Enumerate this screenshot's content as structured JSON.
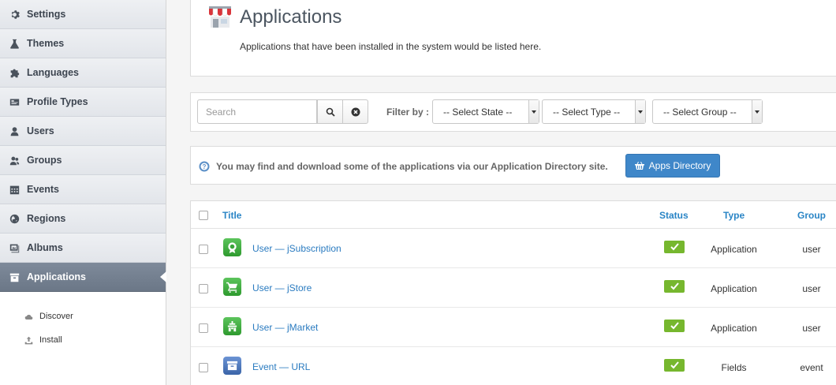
{
  "sidebar": {
    "items": [
      {
        "label": "Settings",
        "icon": "gear-icon"
      },
      {
        "label": "Themes",
        "icon": "flask-icon"
      },
      {
        "label": "Languages",
        "icon": "puzzle-icon"
      },
      {
        "label": "Profile Types",
        "icon": "id-card-icon"
      },
      {
        "label": "Users",
        "icon": "user-icon"
      },
      {
        "label": "Groups",
        "icon": "group-icon"
      },
      {
        "label": "Events",
        "icon": "calendar-icon"
      },
      {
        "label": "Regions",
        "icon": "globe-icon"
      },
      {
        "label": "Albums",
        "icon": "album-icon"
      },
      {
        "label": "Applications",
        "icon": "box-icon",
        "active": true
      }
    ],
    "subitems": [
      {
        "label": "Discover",
        "icon": "cloud-icon"
      },
      {
        "label": "Install",
        "icon": "upload-icon"
      }
    ]
  },
  "header": {
    "title": "Applications",
    "description": "Applications that have been installed in the system would be listed here.",
    "icon": "store-icon"
  },
  "filters": {
    "search_placeholder": "Search",
    "filter_label": "Filter by :",
    "state_select": "-- Select State --",
    "type_select": "-- Select Type --",
    "group_select": "-- Select Group --"
  },
  "info": {
    "text": "You may find and download some of the applications via our Application Directory site.",
    "button_label": "Apps Directory"
  },
  "table": {
    "columns": {
      "title": "Title",
      "status": "Status",
      "type": "Type",
      "group": "Group"
    },
    "rows": [
      {
        "title": "User — jSubscription",
        "type": "Application",
        "group": "user",
        "status": "published",
        "icon_color": "#3aa53a"
      },
      {
        "title": "User — jStore",
        "type": "Application",
        "group": "user",
        "status": "published",
        "icon_color": "#3aa53a"
      },
      {
        "title": "User — jMarket",
        "type": "Application",
        "group": "user",
        "status": "published",
        "icon_color": "#3aa53a"
      },
      {
        "title": "Event — URL",
        "type": "Fields",
        "group": "event",
        "status": "published",
        "icon_color": "#3f6fb8"
      }
    ]
  },
  "colors": {
    "accent": "#2a85c6",
    "status_green": "#76b72e",
    "button_blue": "#3f87c9"
  }
}
